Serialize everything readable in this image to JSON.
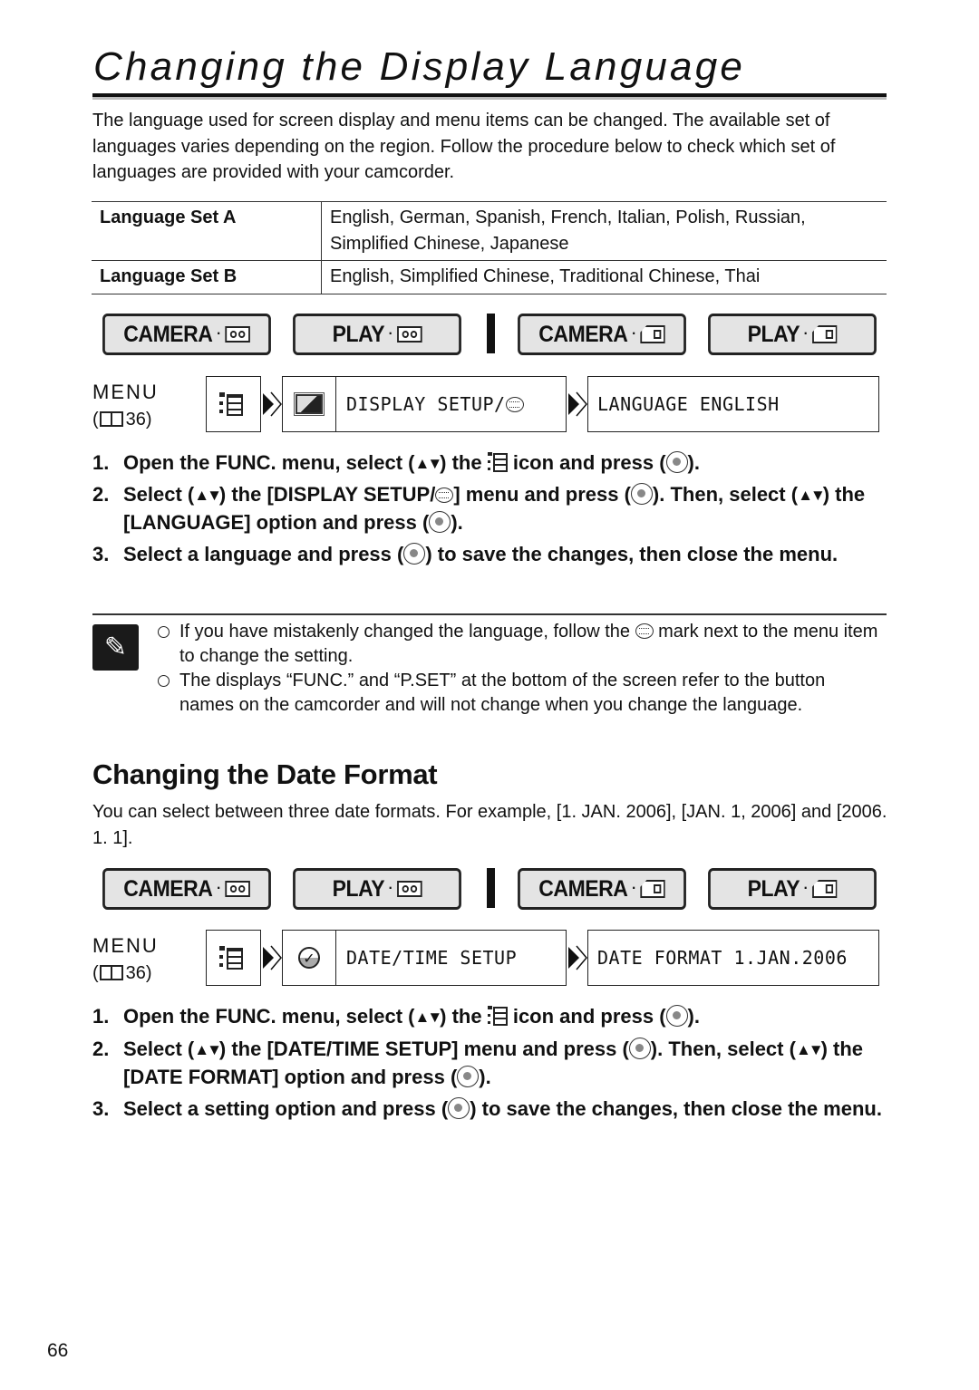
{
  "page": {
    "title": "Changing the Display Language",
    "intro": "The language used for screen display and menu items can be changed. The available set of languages varies depending on the region. Follow the procedure below to check which set of languages are provided with your camcorder.",
    "page_number": "66"
  },
  "language_table": [
    {
      "label": "Language Set A",
      "languages": "English, German, Spanish, French, Italian, Polish, Russian, Simplified Chinese, Japanese"
    },
    {
      "label": "Language Set B",
      "languages": "English, Simplified Chinese, Traditional Chinese, Thai"
    }
  ],
  "mode_buttons": [
    {
      "label": "CAMERA",
      "media_icon": "tape-icon"
    },
    {
      "label": "PLAY",
      "media_icon": "tape-icon"
    },
    {
      "label": "CAMERA",
      "media_icon": "memory-card-icon"
    },
    {
      "label": "PLAY",
      "media_icon": "memory-card-icon"
    }
  ],
  "menu_ref": {
    "label": "MENU",
    "open_paren": "(",
    "page": "36)"
  },
  "section1": {
    "menu_path": {
      "submenu_icon": "display-screen-icon",
      "submenu": "DISPLAY SETUP/",
      "setting": "LANGUAGE ENGLISH"
    },
    "steps": [
      {
        "num": "1.",
        "parts": [
          "Open the FUNC. menu, select (",
          ") the ",
          " icon and press (",
          ")."
        ]
      },
      {
        "num": "2.",
        "parts": [
          "Select (",
          ") the [DISPLAY SETUP/",
          "] menu and press (",
          "). Then, select (",
          ") the [LANGUAGE] option and press (",
          ")."
        ]
      },
      {
        "num": "3.",
        "parts": [
          "Select a language and press (",
          ") to save the changes, then close the menu."
        ]
      }
    ],
    "notes": [
      {
        "parts": [
          "If you have mistakenly changed the language, follow the ",
          " mark next to the menu item to change the setting."
        ]
      },
      {
        "parts": [
          "The displays “FUNC.” and “P.SET” at the bottom of the screen refer to the button names on the camcorder and will not change when you change the language."
        ]
      }
    ]
  },
  "section2": {
    "heading": "Changing the Date Format",
    "intro": "You can select between three date formats. For example, [1. JAN. 2006], [JAN. 1, 2006] and [2006. 1. 1].",
    "menu_path": {
      "submenu_icon": "clock-check-icon",
      "submenu": "DATE/TIME SETUP",
      "setting": "DATE FORMAT 1.JAN.2006"
    },
    "steps": [
      {
        "num": "1.",
        "parts": [
          "Open the FUNC. menu, select (",
          ") the ",
          " icon and press (",
          ")."
        ]
      },
      {
        "num": "2.",
        "parts": [
          "Select (",
          ") the [DATE/TIME SETUP] menu and press (",
          "). Then, select (",
          ") the [DATE FORMAT] option and press (",
          ")."
        ]
      },
      {
        "num": "3.",
        "parts": [
          "Select a setting option and press (",
          ") to save the changes, then close the menu."
        ]
      }
    ]
  },
  "symbols": {
    "up_down": "▲▼",
    "mode_dot": "·",
    "check": "✓",
    "pencil": "✎"
  }
}
